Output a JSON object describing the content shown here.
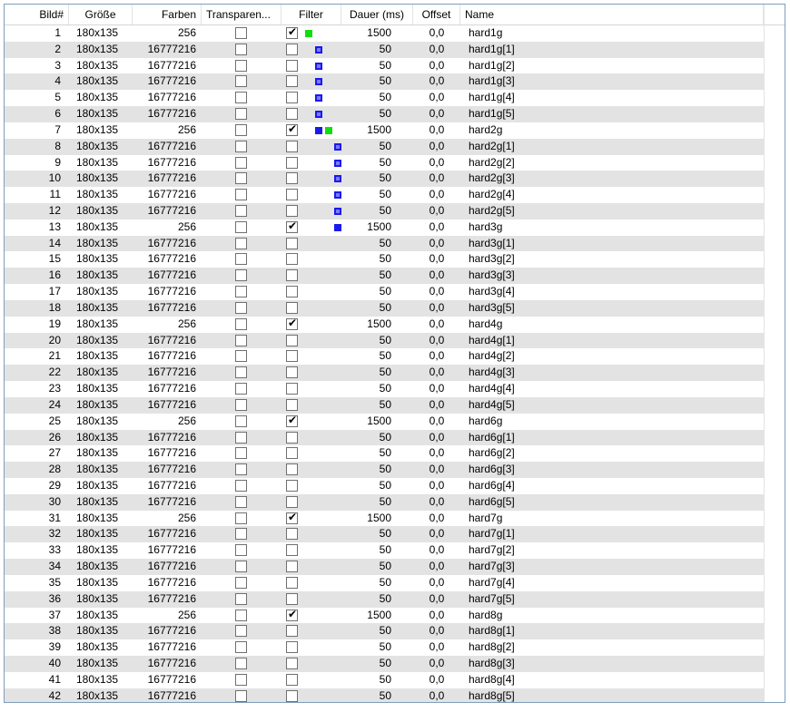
{
  "columns": {
    "bild": "Bild#",
    "groesse": "Größe",
    "farben": "Farben",
    "transparenz": "Transparen...",
    "filter": "Filter",
    "dauer": "Dauer (ms)",
    "offset": "Offset",
    "name": "Name"
  },
  "colors": {
    "row_alt": "#e3e3e3",
    "filter_green": "#11dd11",
    "filter_blue": "#1a1aee",
    "border": "#7f9db9"
  },
  "rows": [
    {
      "n": "1",
      "size": "180x135",
      "colors": "256",
      "transparent": false,
      "filter": true,
      "marks": [
        "green-a"
      ],
      "dur": "1500",
      "offset": "0,0",
      "name": "hard1g"
    },
    {
      "n": "2",
      "size": "180x135",
      "colors": "16777216",
      "transparent": false,
      "filter": false,
      "marks": [
        "blue-hollow-b"
      ],
      "dur": "50",
      "offset": "0,0",
      "name": "hard1g[1]"
    },
    {
      "n": "3",
      "size": "180x135",
      "colors": "16777216",
      "transparent": false,
      "filter": false,
      "marks": [
        "blue-hollow-b"
      ],
      "dur": "50",
      "offset": "0,0",
      "name": "hard1g[2]"
    },
    {
      "n": "4",
      "size": "180x135",
      "colors": "16777216",
      "transparent": false,
      "filter": false,
      "marks": [
        "blue-hollow-b"
      ],
      "dur": "50",
      "offset": "0,0",
      "name": "hard1g[3]"
    },
    {
      "n": "5",
      "size": "180x135",
      "colors": "16777216",
      "transparent": false,
      "filter": false,
      "marks": [
        "blue-hollow-b"
      ],
      "dur": "50",
      "offset": "0,0",
      "name": "hard1g[4]"
    },
    {
      "n": "6",
      "size": "180x135",
      "colors": "16777216",
      "transparent": false,
      "filter": false,
      "marks": [
        "blue-hollow-b"
      ],
      "dur": "50",
      "offset": "0,0",
      "name": "hard1g[5]"
    },
    {
      "n": "7",
      "size": "180x135",
      "colors": "256",
      "transparent": false,
      "filter": true,
      "marks": [
        "blue-b",
        "green-c"
      ],
      "dur": "1500",
      "offset": "0,0",
      "name": "hard2g"
    },
    {
      "n": "8",
      "size": "180x135",
      "colors": "16777216",
      "transparent": false,
      "filter": false,
      "marks": [
        "blue-hollow-d"
      ],
      "dur": "50",
      "offset": "0,0",
      "name": "hard2g[1]"
    },
    {
      "n": "9",
      "size": "180x135",
      "colors": "16777216",
      "transparent": false,
      "filter": false,
      "marks": [
        "blue-hollow-d"
      ],
      "dur": "50",
      "offset": "0,0",
      "name": "hard2g[2]"
    },
    {
      "n": "10",
      "size": "180x135",
      "colors": "16777216",
      "transparent": false,
      "filter": false,
      "marks": [
        "blue-hollow-d"
      ],
      "dur": "50",
      "offset": "0,0",
      "name": "hard2g[3]"
    },
    {
      "n": "11",
      "size": "180x135",
      "colors": "16777216",
      "transparent": false,
      "filter": false,
      "marks": [
        "blue-hollow-d"
      ],
      "dur": "50",
      "offset": "0,0",
      "name": "hard2g[4]"
    },
    {
      "n": "12",
      "size": "180x135",
      "colors": "16777216",
      "transparent": false,
      "filter": false,
      "marks": [
        "blue-hollow-d"
      ],
      "dur": "50",
      "offset": "0,0",
      "name": "hard2g[5]"
    },
    {
      "n": "13",
      "size": "180x135",
      "colors": "256",
      "transparent": false,
      "filter": true,
      "marks": [
        "blue-d"
      ],
      "dur": "1500",
      "offset": "0,0",
      "name": "hard3g"
    },
    {
      "n": "14",
      "size": "180x135",
      "colors": "16777216",
      "transparent": false,
      "filter": false,
      "marks": [],
      "dur": "50",
      "offset": "0,0",
      "name": "hard3g[1]"
    },
    {
      "n": "15",
      "size": "180x135",
      "colors": "16777216",
      "transparent": false,
      "filter": false,
      "marks": [],
      "dur": "50",
      "offset": "0,0",
      "name": "hard3g[2]"
    },
    {
      "n": "16",
      "size": "180x135",
      "colors": "16777216",
      "transparent": false,
      "filter": false,
      "marks": [],
      "dur": "50",
      "offset": "0,0",
      "name": "hard3g[3]"
    },
    {
      "n": "17",
      "size": "180x135",
      "colors": "16777216",
      "transparent": false,
      "filter": false,
      "marks": [],
      "dur": "50",
      "offset": "0,0",
      "name": "hard3g[4]"
    },
    {
      "n": "18",
      "size": "180x135",
      "colors": "16777216",
      "transparent": false,
      "filter": false,
      "marks": [],
      "dur": "50",
      "offset": "0,0",
      "name": "hard3g[5]"
    },
    {
      "n": "19",
      "size": "180x135",
      "colors": "256",
      "transparent": false,
      "filter": true,
      "marks": [],
      "dur": "1500",
      "offset": "0,0",
      "name": "hard4g"
    },
    {
      "n": "20",
      "size": "180x135",
      "colors": "16777216",
      "transparent": false,
      "filter": false,
      "marks": [],
      "dur": "50",
      "offset": "0,0",
      "name": "hard4g[1]"
    },
    {
      "n": "21",
      "size": "180x135",
      "colors": "16777216",
      "transparent": false,
      "filter": false,
      "marks": [],
      "dur": "50",
      "offset": "0,0",
      "name": "hard4g[2]"
    },
    {
      "n": "22",
      "size": "180x135",
      "colors": "16777216",
      "transparent": false,
      "filter": false,
      "marks": [],
      "dur": "50",
      "offset": "0,0",
      "name": "hard4g[3]"
    },
    {
      "n": "23",
      "size": "180x135",
      "colors": "16777216",
      "transparent": false,
      "filter": false,
      "marks": [],
      "dur": "50",
      "offset": "0,0",
      "name": "hard4g[4]"
    },
    {
      "n": "24",
      "size": "180x135",
      "colors": "16777216",
      "transparent": false,
      "filter": false,
      "marks": [],
      "dur": "50",
      "offset": "0,0",
      "name": "hard4g[5]"
    },
    {
      "n": "25",
      "size": "180x135",
      "colors": "256",
      "transparent": false,
      "filter": true,
      "marks": [],
      "dur": "1500",
      "offset": "0,0",
      "name": "hard6g"
    },
    {
      "n": "26",
      "size": "180x135",
      "colors": "16777216",
      "transparent": false,
      "filter": false,
      "marks": [],
      "dur": "50",
      "offset": "0,0",
      "name": "hard6g[1]"
    },
    {
      "n": "27",
      "size": "180x135",
      "colors": "16777216",
      "transparent": false,
      "filter": false,
      "marks": [],
      "dur": "50",
      "offset": "0,0",
      "name": "hard6g[2]"
    },
    {
      "n": "28",
      "size": "180x135",
      "colors": "16777216",
      "transparent": false,
      "filter": false,
      "marks": [],
      "dur": "50",
      "offset": "0,0",
      "name": "hard6g[3]"
    },
    {
      "n": "29",
      "size": "180x135",
      "colors": "16777216",
      "transparent": false,
      "filter": false,
      "marks": [],
      "dur": "50",
      "offset": "0,0",
      "name": "hard6g[4]"
    },
    {
      "n": "30",
      "size": "180x135",
      "colors": "16777216",
      "transparent": false,
      "filter": false,
      "marks": [],
      "dur": "50",
      "offset": "0,0",
      "name": "hard6g[5]"
    },
    {
      "n": "31",
      "size": "180x135",
      "colors": "256",
      "transparent": false,
      "filter": true,
      "marks": [],
      "dur": "1500",
      "offset": "0,0",
      "name": "hard7g"
    },
    {
      "n": "32",
      "size": "180x135",
      "colors": "16777216",
      "transparent": false,
      "filter": false,
      "marks": [],
      "dur": "50",
      "offset": "0,0",
      "name": "hard7g[1]"
    },
    {
      "n": "33",
      "size": "180x135",
      "colors": "16777216",
      "transparent": false,
      "filter": false,
      "marks": [],
      "dur": "50",
      "offset": "0,0",
      "name": "hard7g[2]"
    },
    {
      "n": "34",
      "size": "180x135",
      "colors": "16777216",
      "transparent": false,
      "filter": false,
      "marks": [],
      "dur": "50",
      "offset": "0,0",
      "name": "hard7g[3]"
    },
    {
      "n": "35",
      "size": "180x135",
      "colors": "16777216",
      "transparent": false,
      "filter": false,
      "marks": [],
      "dur": "50",
      "offset": "0,0",
      "name": "hard7g[4]"
    },
    {
      "n": "36",
      "size": "180x135",
      "colors": "16777216",
      "transparent": false,
      "filter": false,
      "marks": [],
      "dur": "50",
      "offset": "0,0",
      "name": "hard7g[5]"
    },
    {
      "n": "37",
      "size": "180x135",
      "colors": "256",
      "transparent": false,
      "filter": true,
      "marks": [],
      "dur": "1500",
      "offset": "0,0",
      "name": "hard8g"
    },
    {
      "n": "38",
      "size": "180x135",
      "colors": "16777216",
      "transparent": false,
      "filter": false,
      "marks": [],
      "dur": "50",
      "offset": "0,0",
      "name": "hard8g[1]"
    },
    {
      "n": "39",
      "size": "180x135",
      "colors": "16777216",
      "transparent": false,
      "filter": false,
      "marks": [],
      "dur": "50",
      "offset": "0,0",
      "name": "hard8g[2]"
    },
    {
      "n": "40",
      "size": "180x135",
      "colors": "16777216",
      "transparent": false,
      "filter": false,
      "marks": [],
      "dur": "50",
      "offset": "0,0",
      "name": "hard8g[3]"
    },
    {
      "n": "41",
      "size": "180x135",
      "colors": "16777216",
      "transparent": false,
      "filter": false,
      "marks": [],
      "dur": "50",
      "offset": "0,0",
      "name": "hard8g[4]"
    },
    {
      "n": "42",
      "size": "180x135",
      "colors": "16777216",
      "transparent": false,
      "filter": false,
      "marks": [],
      "dur": "50",
      "offset": "0,0",
      "name": "hard8g[5]"
    }
  ]
}
